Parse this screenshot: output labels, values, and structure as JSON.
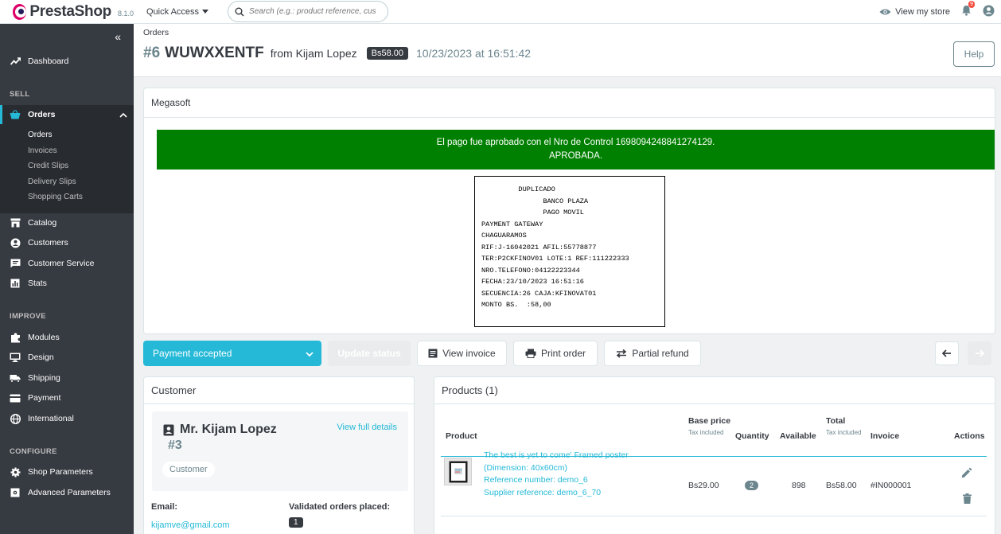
{
  "header": {
    "brand": "PrestaShop",
    "version": "8.1.0",
    "quick_access": "Quick Access",
    "search_placeholder": "Search (e.g.: product reference, custon",
    "view_store": "View my store",
    "notif_count": "9"
  },
  "sidebar": {
    "dashboard": "Dashboard",
    "sell": "SELL",
    "orders": "Orders",
    "orders_sub": [
      "Orders",
      "Invoices",
      "Credit Slips",
      "Delivery Slips",
      "Shopping Carts"
    ],
    "catalog": "Catalog",
    "customers": "Customers",
    "customer_service": "Customer Service",
    "stats": "Stats",
    "improve": "IMPROVE",
    "modules": "Modules",
    "design": "Design",
    "shipping": "Shipping",
    "payment": "Payment",
    "international": "International",
    "configure": "CONFIGURE",
    "shop_parameters": "Shop Parameters",
    "advanced_parameters": "Advanced Parameters"
  },
  "page": {
    "breadcrumb": "Orders",
    "order_num": "#6",
    "reference": "WUWXXENTF",
    "from": "from Kijam Lopez",
    "amount": "Bs58.00",
    "date": "10/23/2023 at 16:51:42",
    "help": "Help"
  },
  "megasoft": {
    "title": "Megasoft",
    "message_line1": "El pago fue aprobado con el Nro de Control 1698094248841274129.",
    "message_line2": "APROBADA.",
    "voucher": "         DUPLICADO\n               BANCO PLAZA\n               PAGO MOVIL\nPAYMENT GATEWAY\nCHAGUARAMOS\nRIF:J-16042021 AFIL:55778877\nTER:P2CKFINOV01 LOTE:1 REF:111222333\nNRO.TELEFONO:04122223344\nFECHA:23/10/2023 16:51:16\nSECUENCIA:26 CAJA:KFINOVAT01\nMONTO BS.  :58,00"
  },
  "actions": {
    "status": "Payment accepted",
    "update_status": "Update status",
    "view_invoice": "View invoice",
    "print_order": "Print order",
    "partial_refund": "Partial refund"
  },
  "customer": {
    "title": "Customer",
    "name": "Mr. Kijam Lopez",
    "id": "#3",
    "view_full": "View full details",
    "badge": "Customer",
    "email_label": "Email:",
    "email": "kijamve@gmail.com",
    "validated_label": "Validated orders placed:",
    "validated_count": "1"
  },
  "products": {
    "title": "Products (1)",
    "columns": {
      "product": "Product",
      "base_price": "Base price",
      "base_price_sub": "Tax included",
      "quantity": "Quantity",
      "available": "Available",
      "total": "Total",
      "total_sub": "Tax included",
      "invoice": "Invoice",
      "actions": "Actions"
    },
    "row": {
      "name": "The best is yet to come' Framed poster",
      "dimension": "(Dimension: 40x60cm)",
      "reference": "Reference number: demo_6",
      "supplier": "Supplier reference: demo_6_70",
      "base_price": "Bs29.00",
      "quantity": "2",
      "available": "898",
      "total": "Bs58.00",
      "invoice": "#IN000001"
    }
  },
  "colors": {
    "accent": "#25b9d7",
    "sidebar": "#363a41",
    "approved": "#008000"
  }
}
